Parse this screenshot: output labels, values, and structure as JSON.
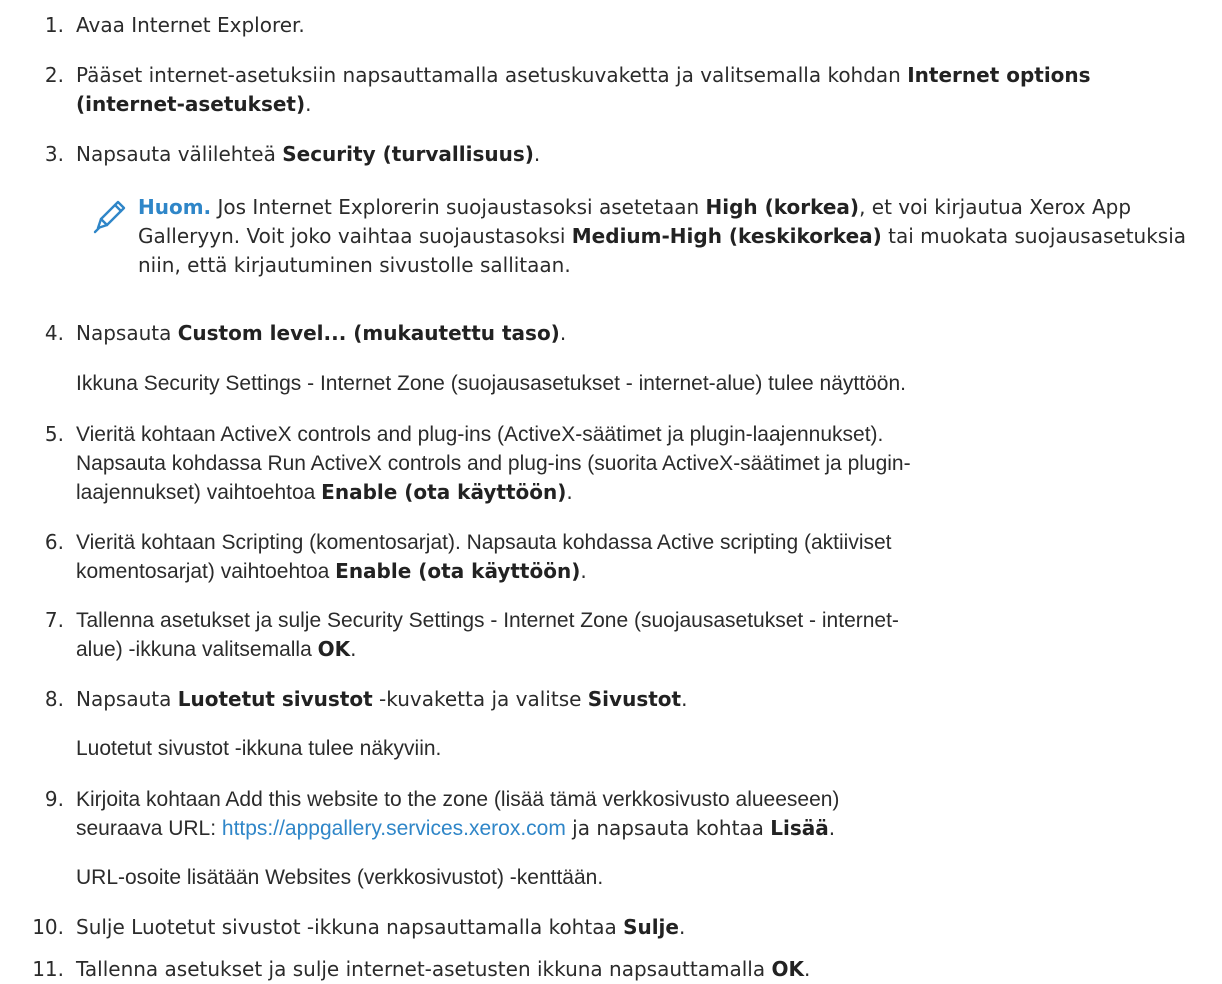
{
  "steps": [
    {
      "n": "1.",
      "parts": [
        "Avaa Internet Explorer."
      ]
    },
    {
      "n": "2.",
      "parts": [
        "Pääset internet-asetuksiin napsauttamalla asetuskuvaketta ja valitsemalla kohdan ",
        "Internet options (internet-asetukset)",
        "."
      ]
    },
    {
      "n": "3.",
      "parts": [
        "Napsauta välilehteä ",
        "Security (turvallisuus)",
        "."
      ]
    },
    {
      "n": "4.",
      "parts": [
        "Napsauta ",
        "Custom level... (mukautettu taso)",
        "."
      ],
      "after": "Ikkuna Security Settings - Internet Zone (suojausasetukset - internet-alue) tulee näyttöön."
    },
    {
      "n": "5.",
      "line1": "Vieritä kohtaan ActiveX controls and plug-ins (ActiveX-säätimet ja plugin-laajennukset).",
      "line2": "Napsauta kohdassa Run ActiveX controls and plug-ins (suorita ActiveX-säätimet ja plugin-",
      "line3a": "laajennukset) vaihtoehtoa ",
      "bold": "Enable (ota käyttöön)",
      "end": "."
    },
    {
      "n": "6.",
      "line1": "Vieritä kohtaan Scripting (komentosarjat). Napsauta kohdassa Active scripting (aktiiviset",
      "line2a": "komentosarjat) vaihtoehtoa ",
      "bold": "Enable (ota käyttöön)",
      "end": "."
    },
    {
      "n": "7.",
      "line1": "Tallenna asetukset ja sulje Security Settings - Internet Zone (suojausasetukset - internet-",
      "line2a": "alue) -ikkuna valitsemalla ",
      "bold": "OK",
      "end": "."
    },
    {
      "n": "8.",
      "a": "Napsauta ",
      "b1": "Luotetut sivustot",
      "c": " -kuvaketta ja valitse ",
      "b2": "Sivustot",
      "end": ".",
      "after": "Luotetut sivustot -ikkuna tulee näkyviin."
    },
    {
      "n": "9.",
      "line1": "Kirjoita kohtaan Add this website to the zone (lisää tämä verkkosivusto alueeseen)",
      "line2a": "seuraava URL: ",
      "url": "https://appgallery.services.xerox.com",
      "line2b": " ja napsauta kohtaa ",
      "bold": "Lisää",
      "end": ".",
      "after": "URL-osoite lisätään Websites (verkkosivustot) -kenttään."
    },
    {
      "n": "10.",
      "a": "Sulje Luotetut sivustot -ikkuna napsauttamalla kohtaa ",
      "bold": "Sulje",
      "end": "."
    },
    {
      "n": "11.",
      "a": "Tallenna asetukset ja sulje internet-asetusten ikkuna napsauttamalla ",
      "bold": "OK",
      "end": "."
    }
  ],
  "note": {
    "icon": "pencil-icon",
    "label": "Huom.",
    "t1": " Jos Internet Explorerin suojaustasoksi asetetaan ",
    "b1": "High (korkea)",
    "t2": ", et voi kirjautua Xerox App Galleryyn. Voit joko vaihtaa suojaustasoksi ",
    "b2": "Medium-High (keskikorkea)",
    "t3": " tai muokata suojausasetuksia niin, että kirjautuminen sivustolle sallitaan."
  },
  "colors": {
    "accent": "#2f86c8",
    "text": "#2b2b2b"
  }
}
